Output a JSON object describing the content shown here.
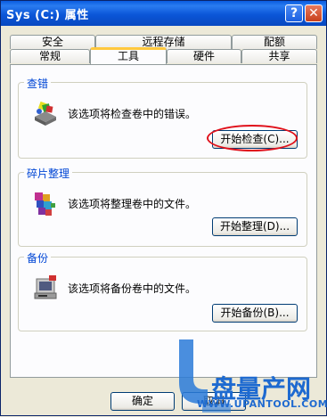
{
  "window": {
    "title": "Sys (C:) 属性"
  },
  "titlebar": {
    "help_glyph": "?",
    "close_glyph": "✕"
  },
  "tabs": {
    "row_back": [
      "安全",
      "远程存储",
      "配额"
    ],
    "row_front": [
      "常规",
      "工具",
      "硬件",
      "共享"
    ],
    "active": "工具"
  },
  "groups": [
    {
      "title": "查错",
      "description": "该选项将检查卷中的错误。",
      "button": "开始检查(C)...",
      "icon": "check-disk-icon"
    },
    {
      "title": "碎片整理",
      "description": "该选项将整理卷中的文件。",
      "button": "开始整理(D)...",
      "icon": "defrag-icon"
    },
    {
      "title": "备份",
      "description": "该选项将备份卷中的文件。",
      "button": "开始备份(B)...",
      "icon": "backup-icon"
    }
  ],
  "footer": {
    "ok": "确定",
    "cancel": "取消"
  },
  "watermark": {
    "brand": "盘量产网",
    "url": "WWW.UPANTOOL.COM"
  },
  "colors": {
    "titlebar": "#0a5be0",
    "group_title": "#0046d5",
    "highlight": "#e0101a",
    "tab_active_accent": "#ffc83c"
  }
}
